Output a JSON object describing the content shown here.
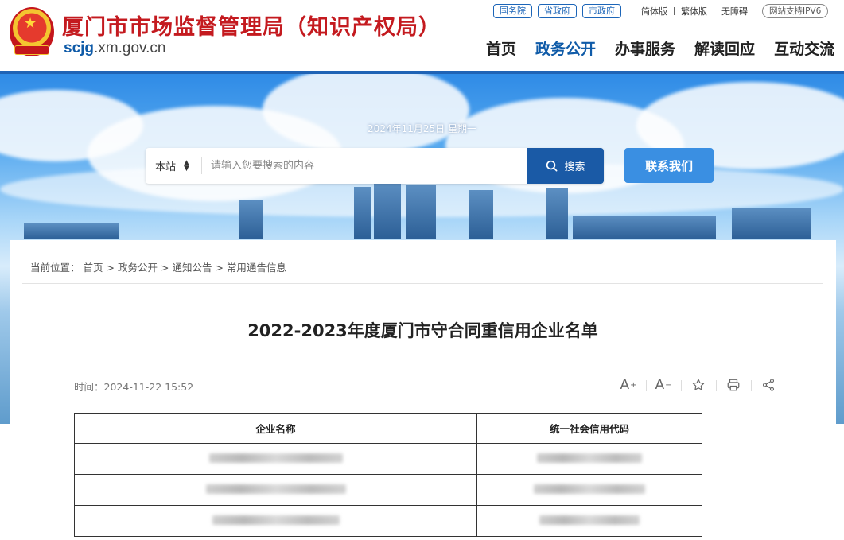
{
  "header": {
    "title": "厦门市市场监督管理局（知识产权局）",
    "domain_bold": "scjg",
    "domain_rest": ".xm.gov.cn",
    "top_tags": [
      "国务院",
      "省政府",
      "市政府"
    ],
    "lang_simplified": "简体版",
    "lang_traditional": "繁体版",
    "accessibility": "无障碍",
    "ipv6": "网站支持IPV6",
    "nav": [
      "首页",
      "政务公开",
      "办事服务",
      "解读回应",
      "互动交流"
    ]
  },
  "banner": {
    "date": "2024年11月25日 星期一",
    "search_scope": "本站",
    "search_placeholder": "请输入您要搜索的内容",
    "search_button": "搜索",
    "contact_button": "联系我们"
  },
  "breadcrumb": {
    "prefix": "当前位置：",
    "items": [
      "首页",
      "政务公开",
      "通知公告",
      "常用通告信息"
    ],
    "separator": ">"
  },
  "article": {
    "title": "2022-2023年度厦门市守合同重信用企业名单",
    "time_label": "时间：",
    "time": "2024-11-22 15:52",
    "table_headers": [
      "企业名称",
      "统一社会信用代码"
    ]
  },
  "colors": {
    "brand_red": "#c41a1f",
    "brand_blue": "#1f63b5",
    "search_button": "#1a5aa6",
    "contact_button": "#3a8fe2"
  }
}
